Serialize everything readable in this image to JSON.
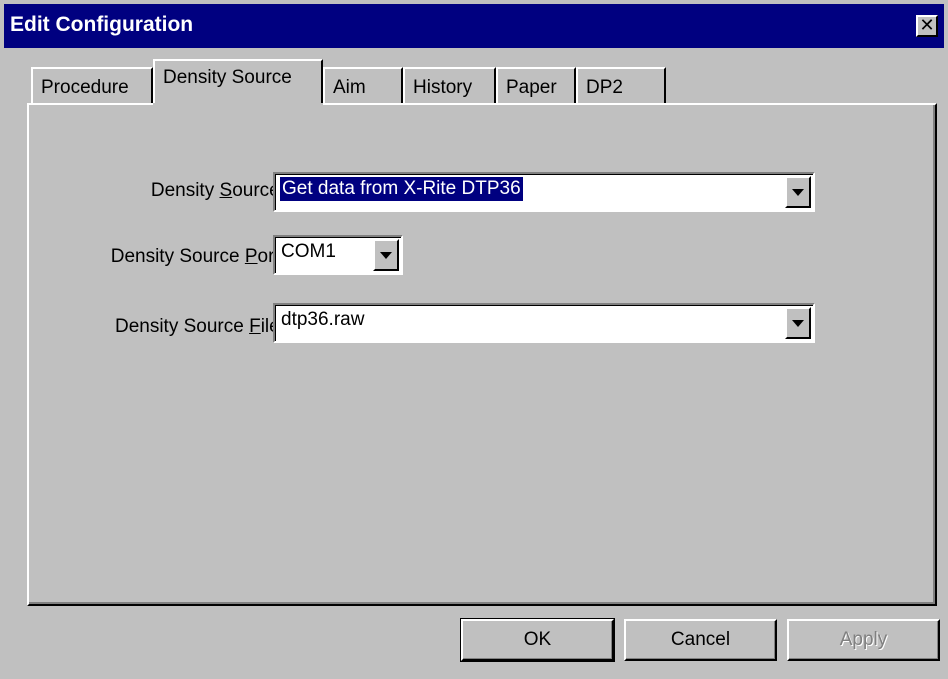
{
  "window": {
    "title": "Edit Configuration",
    "close_icon": "close-icon"
  },
  "tabs": [
    {
      "label": "Procedure",
      "active": false
    },
    {
      "label": "Density Source",
      "active": true
    },
    {
      "label": "Aim",
      "active": false
    },
    {
      "label": "History",
      "active": false
    },
    {
      "label": "Paper",
      "active": false
    },
    {
      "label": "DP2",
      "active": false
    }
  ],
  "form": {
    "density_source": {
      "label_pre": "Density ",
      "label_mnemonic": "S",
      "label_post": "ource:",
      "value": "Get data from X-Rite DTP36"
    },
    "density_source_port": {
      "label_pre": "Density Source ",
      "label_mnemonic": "P",
      "label_post": "ort:",
      "value": "COM1"
    },
    "density_source_file": {
      "label_pre": "Density Source ",
      "label_mnemonic": "F",
      "label_post": "ile:",
      "value": "dtp36.raw"
    }
  },
  "buttons": {
    "ok": "OK",
    "cancel": "Cancel",
    "apply": "Apply"
  },
  "colors": {
    "titlebar": "#000080",
    "face": "#c0c0c0",
    "selection": "#000080"
  }
}
